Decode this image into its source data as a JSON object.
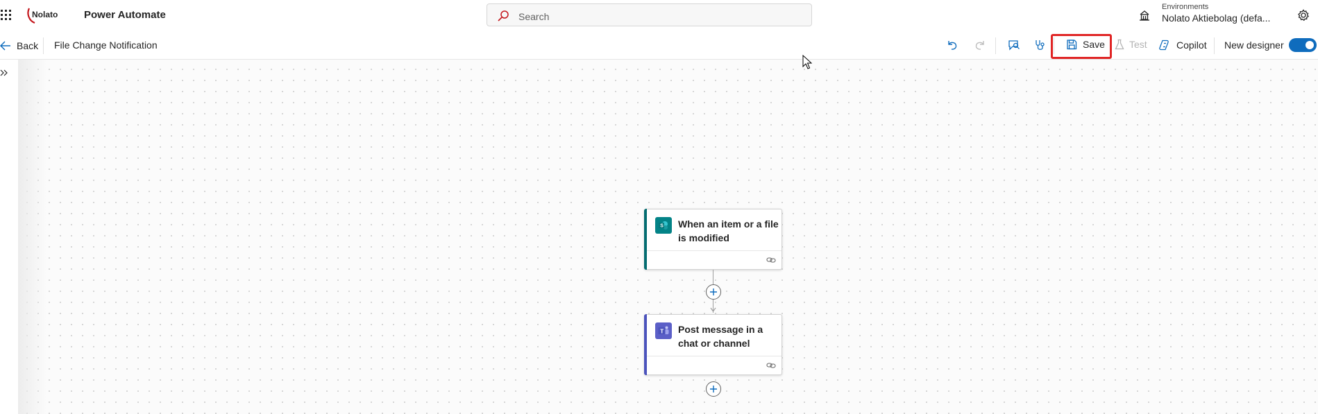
{
  "header": {
    "app_title": "Power Automate",
    "logo_text": "Nolato",
    "search": {
      "placeholder": "Search",
      "value": ""
    },
    "environment": {
      "label": "Environments",
      "value": "Nolato Aktiebolag (defa..."
    }
  },
  "commandbar": {
    "back_label": "Back",
    "flow_name": "File Change Notification",
    "save_label": "Save",
    "test_label": "Test",
    "copilot_label": "Copilot",
    "new_designer_label": "New designer",
    "new_designer_enabled": true,
    "highlight_color": "#e02424"
  },
  "flow": {
    "steps": [
      {
        "title": "When an item or a file is modified",
        "icon": "sharepoint-icon",
        "accent_color": "#036c70",
        "icon_color": "#038387"
      },
      {
        "title": "Post message in a chat or channel",
        "icon": "teams-icon",
        "accent_color": "#4b53bc",
        "icon_color": "#5b5fc7"
      }
    ]
  },
  "colors": {
    "brand": "#0f6cbd",
    "logo_red": "#c4161c"
  }
}
